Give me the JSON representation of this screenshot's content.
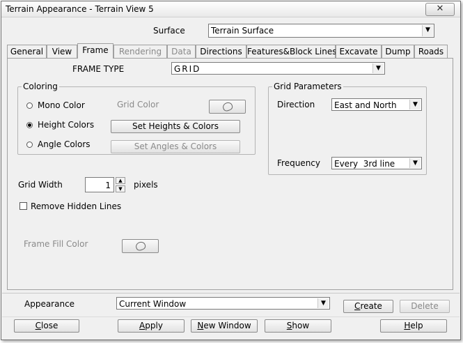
{
  "window": {
    "title": "Terrain Appearance - Terrain View 5",
    "close_glyph": "✕"
  },
  "surface": {
    "label": "Surface",
    "value": "Terrain Surface"
  },
  "tabs": [
    {
      "label": "General",
      "state": "normal"
    },
    {
      "label": "View",
      "state": "normal"
    },
    {
      "label": "Frame",
      "state": "active"
    },
    {
      "label": "Rendering",
      "state": "disabled"
    },
    {
      "label": "Data",
      "state": "disabled"
    },
    {
      "label": "Directions",
      "state": "normal"
    },
    {
      "label": "Features&Block Lines",
      "state": "normal"
    },
    {
      "label": "Excavate",
      "state": "normal"
    },
    {
      "label": "Dump",
      "state": "normal"
    },
    {
      "label": "Roads",
      "state": "normal"
    }
  ],
  "frame": {
    "type_label": "FRAME TYPE",
    "type_value": "GRID",
    "coloring": {
      "title": "Coloring",
      "options": [
        "Mono Color",
        "Height Colors",
        "Angle Colors"
      ],
      "selected": "Height Colors",
      "grid_color_label": "Grid Color",
      "set_heights_label": "Set Heights & Colors",
      "set_angles_label": "Set Angles & Colors"
    },
    "grid_parameters": {
      "title": "Grid Parameters",
      "direction_label": "Direction",
      "direction_value": "East and North",
      "frequency_label": "Frequency",
      "frequency_value": "Every  3rd line"
    },
    "grid_width": {
      "label": "Grid Width",
      "value": "1",
      "unit": "pixels"
    },
    "remove_hidden_lines": {
      "label": "Remove Hidden Lines",
      "checked": false
    },
    "frame_fill_color_label": "Frame Fill Color"
  },
  "appearance": {
    "label": "Appearance",
    "value": "Current Window"
  },
  "buttons": {
    "create": {
      "mnemonic": "C",
      "rest": "reate"
    },
    "delete": "Delete",
    "close": {
      "mnemonic": "C",
      "rest": "lose"
    },
    "apply": {
      "mnemonic": "A",
      "rest": "pply"
    },
    "new_window": {
      "mnemonic": "N",
      "rest": "ew Window"
    },
    "show": {
      "mnemonic": "S",
      "rest": "how"
    },
    "help": {
      "mnemonic": "H",
      "rest": "elp"
    }
  }
}
